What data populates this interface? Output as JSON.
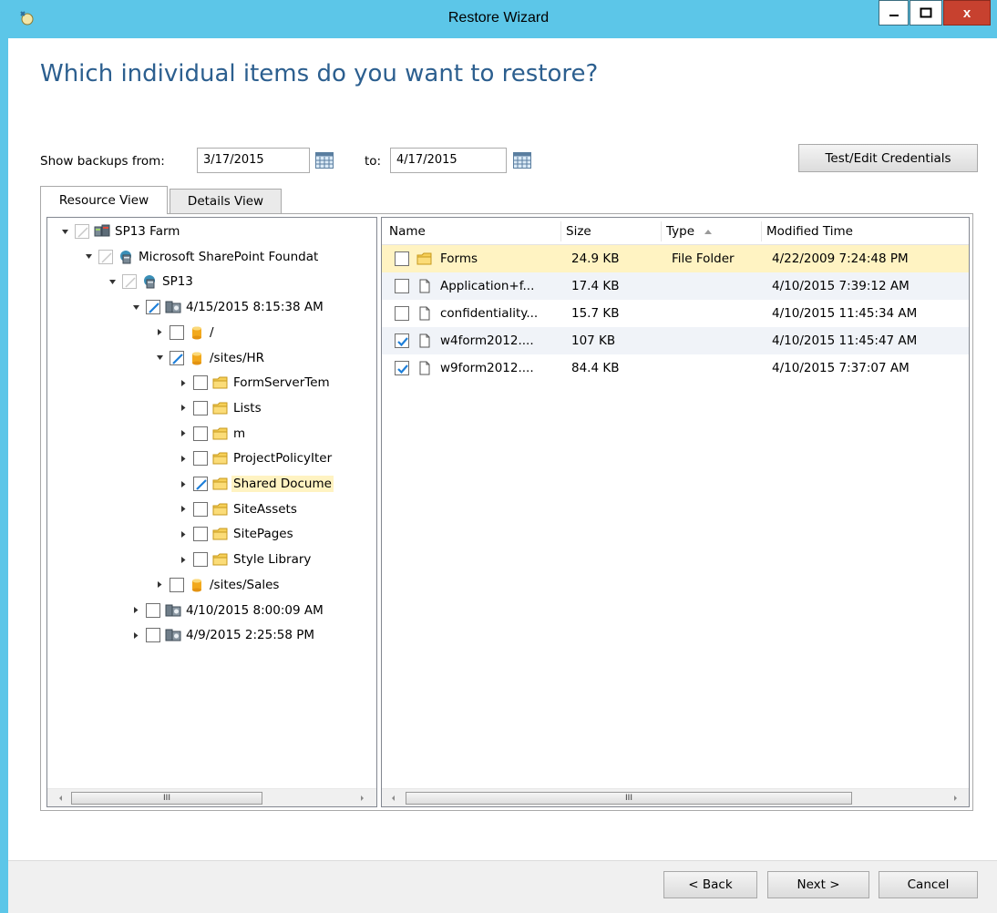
{
  "window": {
    "title": "Restore Wizard",
    "close_label": "x"
  },
  "page": {
    "heading": "Which individual items do you want to restore?"
  },
  "filters": {
    "from_label": "Show backups from:",
    "from_value": "3/17/2015",
    "to_label": "to:",
    "to_value": "4/17/2015",
    "credentials_button": "Test/Edit Credentials"
  },
  "tabs": [
    {
      "label": "Resource View",
      "active": true
    },
    {
      "label": "Details View",
      "active": false
    }
  ],
  "tree": [
    {
      "label": "SP13 Farm",
      "level": 0,
      "expander": "expanded",
      "check": "disabled",
      "icon": "farm-icon"
    },
    {
      "label": "Microsoft SharePoint Foundat",
      "level": 1,
      "expander": "expanded",
      "check": "disabled",
      "icon": "server-icon"
    },
    {
      "label": "SP13",
      "level": 2,
      "expander": "expanded",
      "check": "disabled",
      "icon": "server-icon"
    },
    {
      "label": "4/15/2015 8:15:38 AM",
      "level": 3,
      "expander": "expanded",
      "check": "partial",
      "icon": "backup-icon"
    },
    {
      "label": "/",
      "level": 4,
      "expander": "collapsed",
      "check": "unchecked",
      "icon": "database-icon"
    },
    {
      "label": "/sites/HR",
      "level": 4,
      "expander": "expanded",
      "check": "partial",
      "icon": "database-icon"
    },
    {
      "label": "FormServerTem",
      "level": 5,
      "expander": "collapsed",
      "check": "unchecked",
      "icon": "folder-icon"
    },
    {
      "label": "Lists",
      "level": 5,
      "expander": "collapsed",
      "check": "unchecked",
      "icon": "folder-icon"
    },
    {
      "label": "m",
      "level": 5,
      "expander": "collapsed",
      "check": "unchecked",
      "icon": "folder-icon"
    },
    {
      "label": "ProjectPolicyIter",
      "level": 5,
      "expander": "collapsed",
      "check": "unchecked",
      "icon": "folder-icon"
    },
    {
      "label": "Shared Docume",
      "level": 5,
      "expander": "collapsed",
      "check": "partial",
      "icon": "folder-icon",
      "selected": true
    },
    {
      "label": "SiteAssets",
      "level": 5,
      "expander": "collapsed",
      "check": "unchecked",
      "icon": "folder-icon"
    },
    {
      "label": "SitePages",
      "level": 5,
      "expander": "collapsed",
      "check": "unchecked",
      "icon": "folder-icon"
    },
    {
      "label": "Style Library",
      "level": 5,
      "expander": "collapsed",
      "check": "unchecked",
      "icon": "folder-icon"
    },
    {
      "label": "/sites/Sales",
      "level": 4,
      "expander": "collapsed",
      "check": "unchecked",
      "icon": "database-icon"
    },
    {
      "label": "4/10/2015 8:00:09 AM",
      "level": 3,
      "expander": "collapsed",
      "check": "unchecked",
      "icon": "backup-icon"
    },
    {
      "label": "4/9/2015 2:25:58 PM",
      "level": 3,
      "expander": "collapsed",
      "check": "unchecked",
      "icon": "backup-icon"
    }
  ],
  "grid": {
    "columns": {
      "name": "Name",
      "size": "Size",
      "type": "Type",
      "modified": "Modified Time"
    },
    "sort_indicator": "ascending",
    "rows": [
      {
        "name": "Forms",
        "size": "24.9 KB",
        "type": "File Folder",
        "modified": "4/22/2009 7:24:48 PM",
        "checked": false,
        "icon": "folder-icon",
        "selected": true
      },
      {
        "name": "Application+f...",
        "size": "17.4 KB",
        "type": "",
        "modified": "4/10/2015 7:39:12 AM",
        "checked": false,
        "icon": "file-icon"
      },
      {
        "name": "confidentiality...",
        "size": "15.7 KB",
        "type": "",
        "modified": "4/10/2015 11:45:34 AM",
        "checked": false,
        "icon": "file-icon"
      },
      {
        "name": "w4form2012....",
        "size": "107 KB",
        "type": "",
        "modified": "4/10/2015 11:45:47 AM",
        "checked": true,
        "icon": "file-icon"
      },
      {
        "name": "w9form2012....",
        "size": "84.4 KB",
        "type": "",
        "modified": "4/10/2015 7:37:07 AM",
        "checked": true,
        "icon": "file-icon"
      }
    ]
  },
  "scroll_grip": "III",
  "footer": {
    "back": "< Back",
    "next": "Next >",
    "cancel": "Cancel"
  },
  "colors": {
    "title_bar": "#5cc6e8",
    "heading": "#2c5f8f",
    "selection": "#fff3c2",
    "check": "#1e7fd9",
    "close": "#c7412f"
  }
}
